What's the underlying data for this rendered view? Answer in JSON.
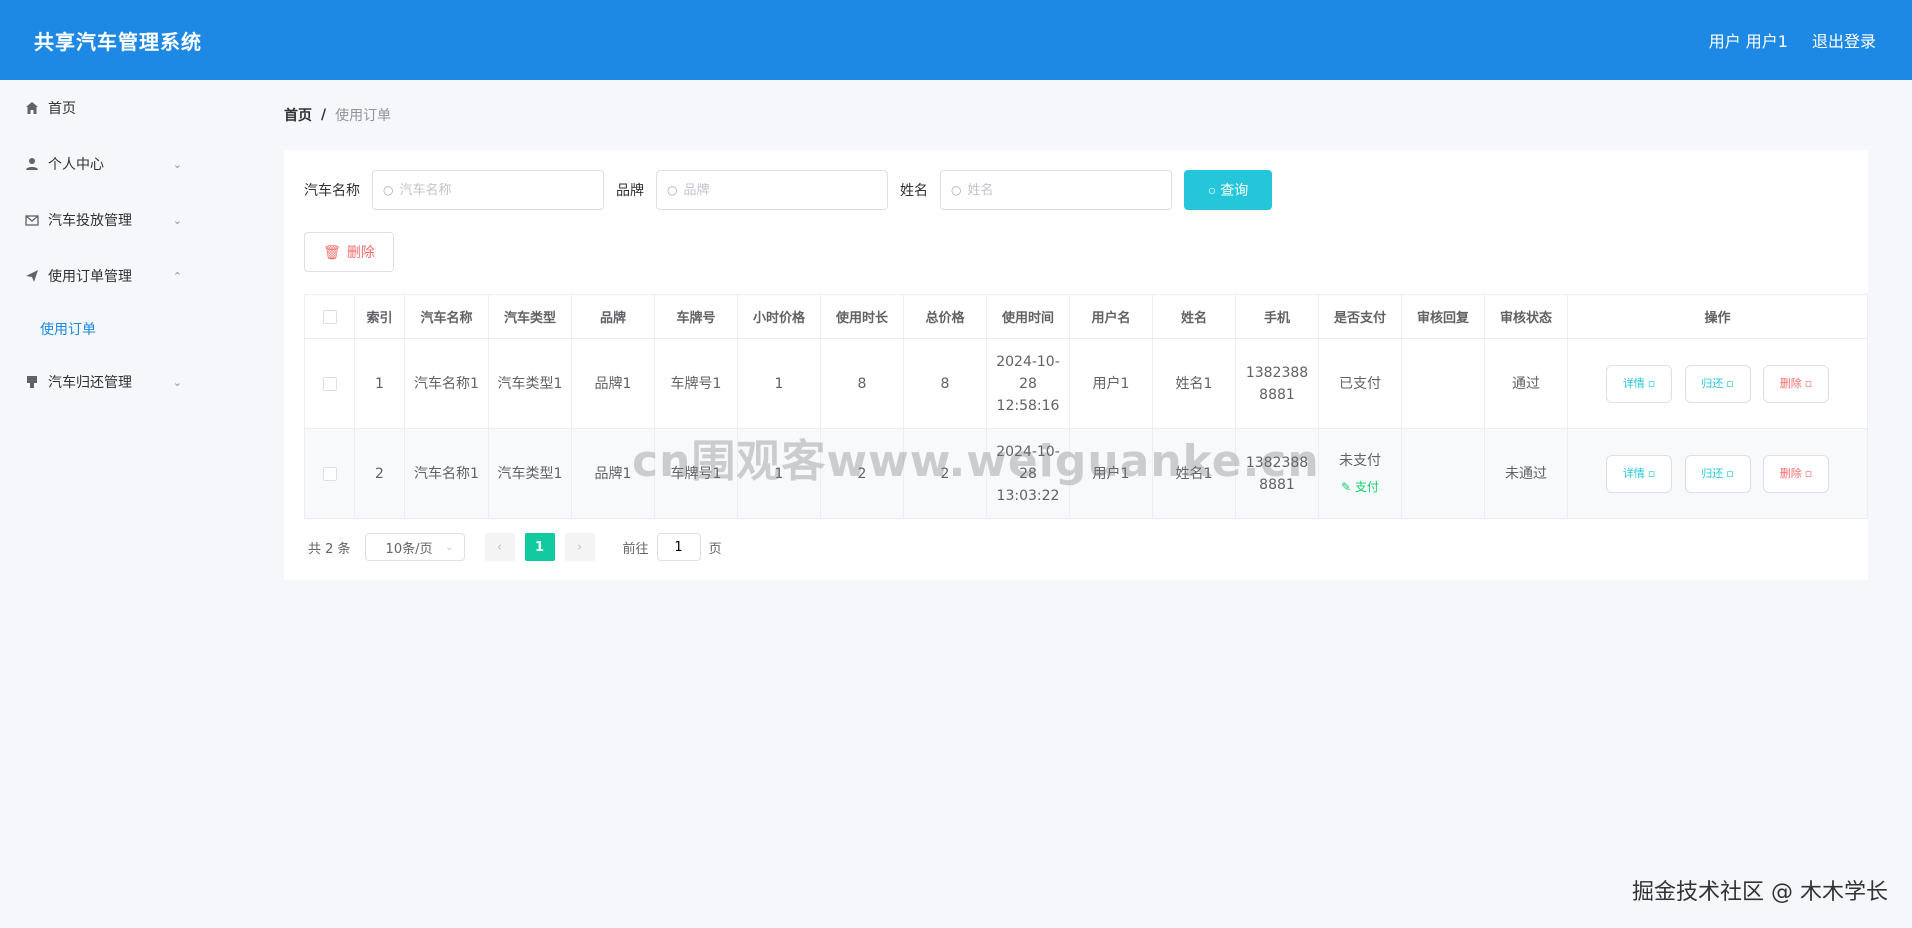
{
  "header": {
    "title": "共享汽车管理系统",
    "user_label": "用户 用户1",
    "logout_label": "退出登录"
  },
  "sidebar": {
    "items": [
      {
        "label": "首页",
        "icon": "home-icon"
      },
      {
        "label": "个人中心",
        "icon": "user-icon"
      },
      {
        "label": "汽车投放管理",
        "icon": "mail-icon"
      },
      {
        "label": "使用订单管理",
        "icon": "send-icon"
      },
      {
        "label": "汽车归还管理",
        "icon": "stamp-icon"
      }
    ],
    "sub_item": "使用订单"
  },
  "breadcrumb": {
    "home": "首页",
    "separator": "/",
    "current": "使用订单"
  },
  "filters": {
    "car_name_label": "汽车名称",
    "car_name_placeholder": "汽车名称",
    "brand_label": "品牌",
    "brand_placeholder": "品牌",
    "name_label": "姓名",
    "name_placeholder": "姓名",
    "query_label": "查询"
  },
  "delete_label": "删除",
  "table": {
    "headers": [
      "索引",
      "汽车名称",
      "汽车类型",
      "品牌",
      "车牌号",
      "小时价格",
      "使用时长",
      "总价格",
      "使用时间",
      "用户名",
      "姓名",
      "手机",
      "是否支付",
      "审核回复",
      "审核状态",
      "操作"
    ],
    "rows": [
      {
        "index": "1",
        "car_name": "汽车名称1",
        "car_type": "汽车类型1",
        "brand": "品牌1",
        "plate": "车牌号1",
        "hourly": "1",
        "duration": "8",
        "total": "8",
        "time": "2024-10-28 12:58:16",
        "username": "用户1",
        "name": "姓名1",
        "phone": "13823888881",
        "paid": "已支付",
        "pay_link": "",
        "reply": "",
        "status": "通过"
      },
      {
        "index": "2",
        "car_name": "汽车名称1",
        "car_type": "汽车类型1",
        "brand": "品牌1",
        "plate": "车牌号1",
        "hourly": "1",
        "duration": "2",
        "total": "2",
        "time": "2024-10-28 13:03:22",
        "username": "用户1",
        "name": "姓名1",
        "phone": "13823888881",
        "paid": "未支付",
        "pay_link": "支付",
        "reply": "",
        "status": "未通过"
      }
    ],
    "actions": {
      "detail": "详情",
      "return": "归还",
      "delete": "删除"
    }
  },
  "pager": {
    "total": "共 2 条",
    "page_size": "10条/页",
    "current_page": "1",
    "goto_prefix": "前往",
    "goto_value": "1",
    "goto_suffix": "页"
  },
  "watermark": "cn围观客www.weiguanke.cn",
  "signature": "掘金技术社区 @ 木木学长",
  "colors": {
    "header": "#1e88e5",
    "query": "#26c6da",
    "danger": "#f56c6c",
    "active_page": "#13c9a0"
  }
}
